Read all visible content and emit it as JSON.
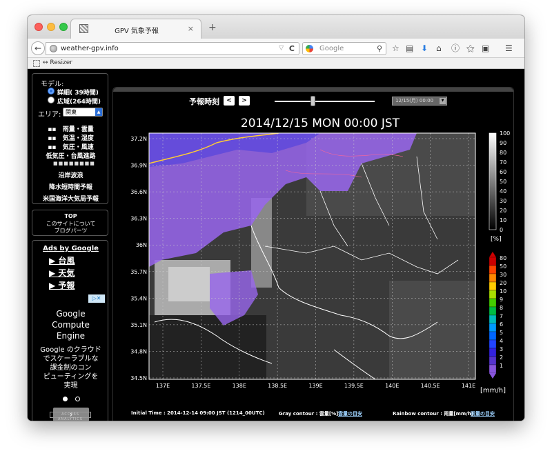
{
  "browser": {
    "tab_title": "GPV 気象予報",
    "tab_close": "×",
    "new_tab": "+",
    "url": "weather-gpv.info",
    "search_placeholder": "Google",
    "bookmark_label": "↔ Resizer"
  },
  "sidebar": {
    "model_label": "モデル:",
    "models": [
      {
        "label": "詳細( 39時間)",
        "selected": true
      },
      {
        "label": "広域(264時間)",
        "selected": false
      }
    ],
    "area_label": "エリア:",
    "area_value": "関東",
    "menu": [
      "雨量・雲量",
      "気温・湿度",
      "気圧・風速",
      "低気圧・台風進路"
    ],
    "menu_separator": "■■■■■■■■",
    "menu2": [
      "沿岸波浪",
      "降水短時間予報",
      "米国海洋大気局予報"
    ],
    "links": [
      "TOP",
      "このサイトについて",
      "ブログパーツ"
    ],
    "ads": {
      "title": "Ads by Google",
      "links": [
        "▶ 台風",
        "▶ 天気",
        "▶ 予報"
      ],
      "adchoices": "▷✕",
      "gce_title": [
        "Google",
        "Compute",
        "Engine"
      ],
      "gce_body": [
        "Google のクラウド",
        "でスケーラブルな",
        "課金制のコン",
        "ピューティングを",
        "実現"
      ],
      "next": "›",
      "analytics": "ACCESS ANALYTICS"
    }
  },
  "main": {
    "forecast_label": "予報時刻",
    "prev": "<",
    "next": ">",
    "slider_position": 0.38,
    "time_select": "12/15(月) 00:00",
    "map_title": "2014/12/15 MON 00:00 JST",
    "lat_labels": [
      "37.2N",
      "36.9N",
      "36.6N",
      "36.3N",
      "36N",
      "35.7N",
      "35.4N",
      "35.1N",
      "34.8N",
      "34.5N"
    ],
    "lon_labels": [
      "137E",
      "137.5E",
      "138E",
      "138.5E",
      "139E",
      "139.5E",
      "140E",
      "140.5E",
      "141E"
    ],
    "cloud_scale": {
      "labels": [
        "100",
        "90",
        "80",
        "70",
        "60",
        "50",
        "40",
        "30",
        "20",
        "10",
        "0"
      ],
      "unit": "[%]"
    },
    "rain_scale": {
      "labels": [
        "80",
        "50",
        "30",
        "20",
        "10",
        "9",
        "8",
        "7",
        "6",
        "5",
        "4",
        "3",
        "2",
        "1"
      ],
      "colors": [
        "#cc0000",
        "#ff4400",
        "#ff8800",
        "#ffcc00",
        "#aadd00",
        "#44cc00",
        "#00bb44",
        "#00bbbb",
        "#0099ff",
        "#0066ff",
        "#2244ff",
        "#3322dd",
        "#5533cc",
        "#8855dd"
      ],
      "unit": "[mm/h]"
    },
    "footer": {
      "initial_time": "Initial Time : 2014-12-14 09:00 JST (1214_00UTC)",
      "gray_contour": "Gray contour : 雲量[%]",
      "gray_link": "雲量の目安",
      "rainbow_contour": "Rainbow contour : 雨量[mm/h]",
      "rainbow_link": "雨量の目安"
    }
  },
  "colors": {
    "precip_purple": "#9966ee",
    "background": "#000000"
  }
}
